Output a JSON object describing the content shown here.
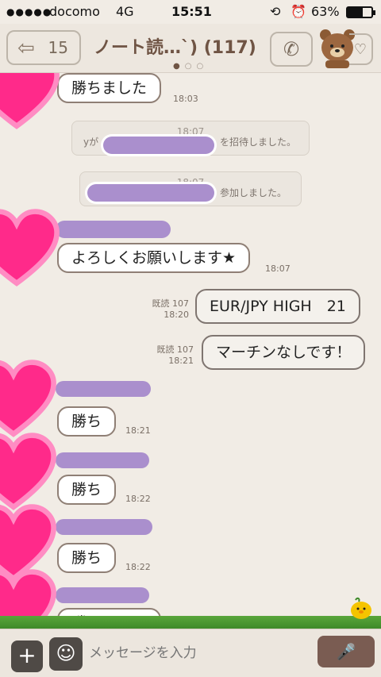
{
  "status_bar": {
    "signal_dots": "●●●●●",
    "carrier": "docomo",
    "network": "4G",
    "time": "15:51",
    "battery": "63%",
    "battery_level": 0.63
  },
  "header": {
    "back_count": "15",
    "title": "ノート読…`) (117)",
    "page_indicator_count": 3,
    "active_page": 1
  },
  "messages": {
    "m1": {
      "text": "勝ちました",
      "time": "18:03"
    },
    "sys1": {
      "time": "18:07",
      "prefix": "yが",
      "text": "を招待しました。"
    },
    "sys2": {
      "time": "18:07",
      "text": "参加しました。"
    },
    "m2": {
      "text": "よろしくお願いします★",
      "time": "18:07"
    },
    "m3": {
      "text": "EUR/JPY HIGH　21",
      "read": "既読 107",
      "time": "18:20"
    },
    "m4": {
      "text": "マーチンなしです！",
      "read": "既読 107",
      "time": "18:21"
    },
    "m5": {
      "text": "勝ち",
      "time": "18:21"
    },
    "m6": {
      "text": "勝ち",
      "time": "18:22"
    },
    "m7": {
      "text": "勝ち",
      "time": "18:22"
    },
    "m8": {
      "text": "勝ちました"
    }
  },
  "input": {
    "placeholder": "メッセージを入力"
  },
  "icons": {
    "back": "back-arrow-icon",
    "call": "phone-icon",
    "avatar": "brown-bear-icon",
    "menu": "chevron-down-icon",
    "plus": "plus-icon",
    "emoji": "smiley-icon",
    "mic": "microphone-icon"
  },
  "colors": {
    "background": "#f1ece5",
    "redaction": "#aa8fcd",
    "heart": "#ff2a8a",
    "title": "#6f5444"
  }
}
